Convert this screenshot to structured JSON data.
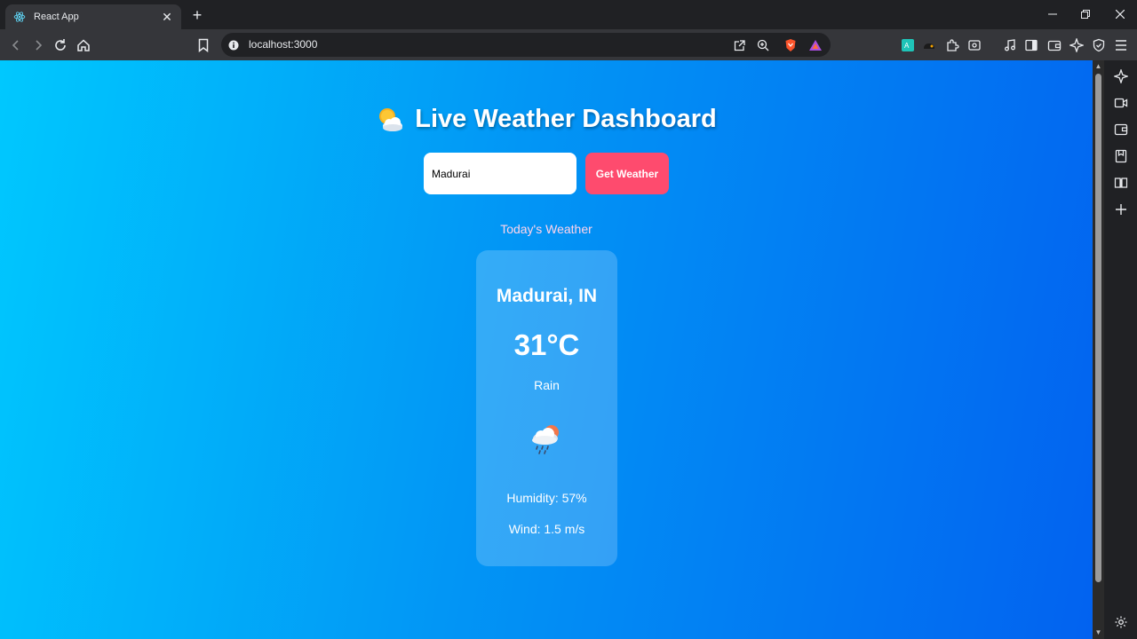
{
  "browser": {
    "tab_title": "React App",
    "url": "localhost:3000"
  },
  "app": {
    "title": "Live Weather Dashboard",
    "title_icon": "sun-behind-cloud-icon",
    "search": {
      "value": "Madurai",
      "button_label": "Get Weather"
    },
    "section_label": "Today's Weather",
    "card": {
      "city": "Madurai, IN",
      "temperature": "31°C",
      "condition": "Rain",
      "condition_icon": "rain-cloud-icon",
      "humidity": "Humidity: 57%",
      "wind": "Wind: 1.5 m/s"
    }
  },
  "colors": {
    "gradient_start": "#00c8fe",
    "gradient_end": "#0262f0",
    "button": "#fe4b6e",
    "section_label": "#ffd4ea"
  }
}
